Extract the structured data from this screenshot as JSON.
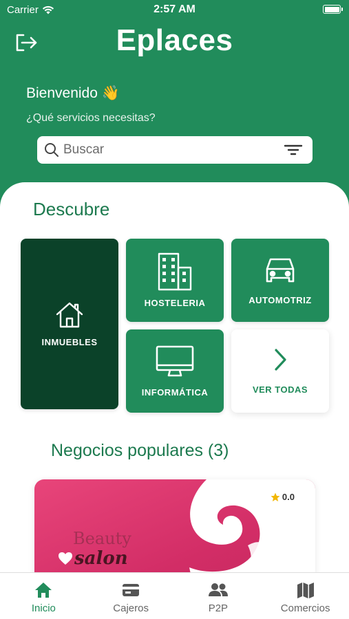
{
  "status_bar": {
    "carrier": "Carrier",
    "time": "2:57 AM"
  },
  "header": {
    "title": "Eplaces",
    "welcome": "Bienvenido",
    "welcome_emoji": "👋",
    "subtitle": "¿Qué servicios necesitas?",
    "logout_icon": "logout-icon"
  },
  "search": {
    "placeholder": "Buscar",
    "value": "",
    "filter_icon": "filter-icon"
  },
  "discover": {
    "title": "Descubre",
    "categories": [
      {
        "label": "INMUEBLES",
        "icon": "house-icon"
      },
      {
        "label": "HOSTELERIA",
        "icon": "buildings-icon"
      },
      {
        "label": "AUTOMOTRIZ",
        "icon": "car-icon"
      },
      {
        "label": "INFORMÁTICA",
        "icon": "monitor-icon"
      },
      {
        "label": "VER TODAS",
        "icon": "chevron-right-icon"
      }
    ]
  },
  "popular": {
    "title": "Negocios populares (3)",
    "businesses": [
      {
        "rating": "0.0",
        "image_text_1": "Beauty",
        "image_text_2": "salon"
      }
    ]
  },
  "tabbar": {
    "tabs": [
      {
        "label": "Inicio",
        "icon": "home-icon",
        "active": true
      },
      {
        "label": "Cajeros",
        "icon": "card-icon",
        "active": false
      },
      {
        "label": "P2P",
        "icon": "people-icon",
        "active": false
      },
      {
        "label": "Comercios",
        "icon": "map-icon",
        "active": false
      }
    ]
  },
  "colors": {
    "primary": "#218c5b",
    "dark": "#0b4229",
    "accent_text": "#1d7a4f"
  }
}
